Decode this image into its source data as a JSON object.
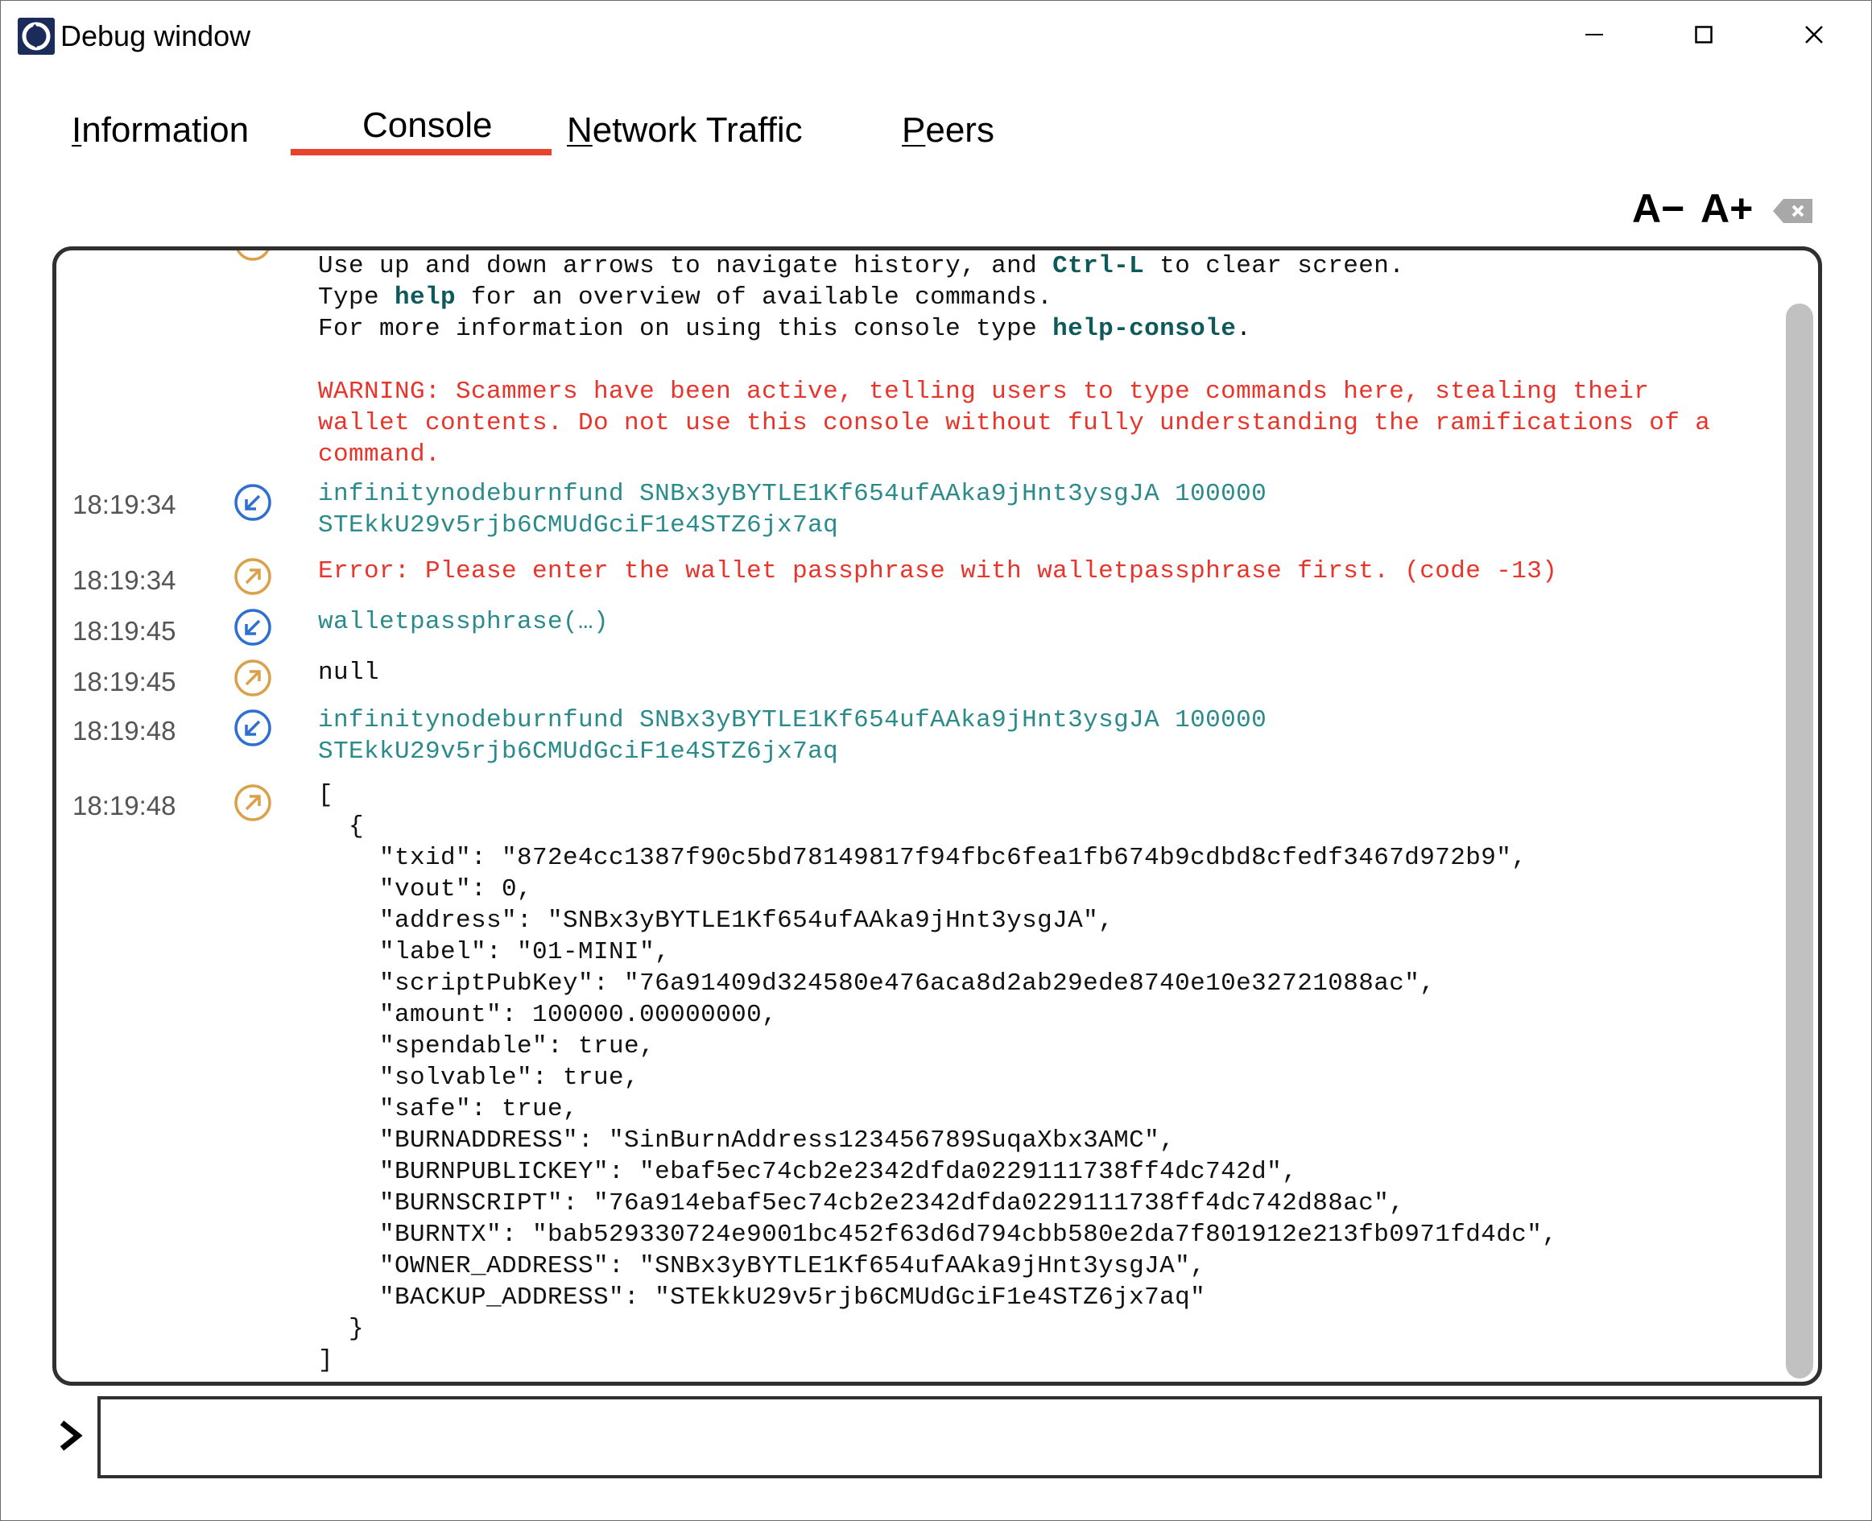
{
  "window": {
    "title": "Debug window"
  },
  "tabs": [
    {
      "first": "I",
      "rest": "nformation"
    },
    {
      "first": "C",
      "rest": "onsole"
    },
    {
      "first": "N",
      "rest": "etwork Traffic"
    },
    {
      "first": "P",
      "rest": "eers"
    }
  ],
  "active_tab": "Console",
  "toolbar": {
    "font_decrease": "A−",
    "font_increase": "A+"
  },
  "intro": {
    "line1_a": "Use up and down arrows to navigate history, and ",
    "line1_key": "Ctrl-L",
    "line1_b": " to clear screen.",
    "line2_a": "Type ",
    "line2_key": "help",
    "line2_b": " for an overview of available commands.",
    "line3_a": "For more information on using this console type ",
    "line3_key": "help-console",
    "line3_b": ".",
    "warning": "WARNING: Scammers have been active, telling users to type commands here, stealing their\nwallet contents. Do not use this console without fully understanding the ramifications of a\ncommand."
  },
  "messages": [
    {
      "time": "18:19:34",
      "dir": "in",
      "text": "infinitynodeburnfund SNBx3yBYTLE1Kf654ufAAka9jHnt3ysgJA 100000\nSTEkkU29v5rjb6CMUdGciF1e4STZ6jx7aq"
    },
    {
      "time": "18:19:34",
      "dir": "out",
      "text": "Error: Please enter the wallet passphrase with walletpassphrase first. (code -13)"
    },
    {
      "time": "18:19:45",
      "dir": "in",
      "text": "walletpassphrase(…)"
    },
    {
      "time": "18:19:45",
      "dir": "out",
      "text": "null"
    },
    {
      "time": "18:19:48",
      "dir": "in",
      "text": "infinitynodeburnfund SNBx3yBYTLE1Kf654ufAAka9jHnt3ysgJA 100000\nSTEkkU29v5rjb6CMUdGciF1e4STZ6jx7aq"
    },
    {
      "time": "18:19:48",
      "dir": "out",
      "text": "[\n  {\n    \"txid\": \"872e4cc1387f90c5bd78149817f94fbc6fea1fb674b9cdbd8cfedf3467d972b9\",\n    \"vout\": 0,\n    \"address\": \"SNBx3yBYTLE1Kf654ufAAka9jHnt3ysgJA\",\n    \"label\": \"01-MINI\",\n    \"scriptPubKey\": \"76a91409d324580e476aca8d2ab29ede8740e10e32721088ac\",\n    \"amount\": 100000.00000000,\n    \"spendable\": true,\n    \"solvable\": true,\n    \"safe\": true,\n    \"BURNADDRESS\": \"SinBurnAddress123456789SuqaXbx3AMC\",\n    \"BURNPUBLICKEY\": \"ebaf5ec74cb2e2342dfda0229111738ff4dc742d\",\n    \"BURNSCRIPT\": \"76a914ebaf5ec74cb2e2342dfda0229111738ff4dc742d88ac\",\n    \"BURNTX\": \"bab529330724e9001bc452f63d6d794cbb580e2da7f801912e213fb0971fd4dc\",\n    \"OWNER_ADDRESS\": \"SNBx3yBYTLE1Kf654ufAAka9jHnt3ysgJA\",\n    \"BACKUP_ADDRESS\": \"STEkkU29v5rjb6CMUdGciF1e4STZ6jx7aq\"\n  }\n]"
    }
  ],
  "input": {
    "value": ""
  },
  "colors": {
    "accent": "#e8412c",
    "incoming": "#2f6fd1",
    "outgoing": "#d9a14a",
    "command_text": "#2b8a8a",
    "error_text": "#e8352c"
  },
  "icons": {
    "incoming": "arrow-in-circle-icon",
    "outgoing": "arrow-out-circle-icon",
    "prompt": "chevron-right-icon",
    "clear": "clear-console-icon"
  }
}
